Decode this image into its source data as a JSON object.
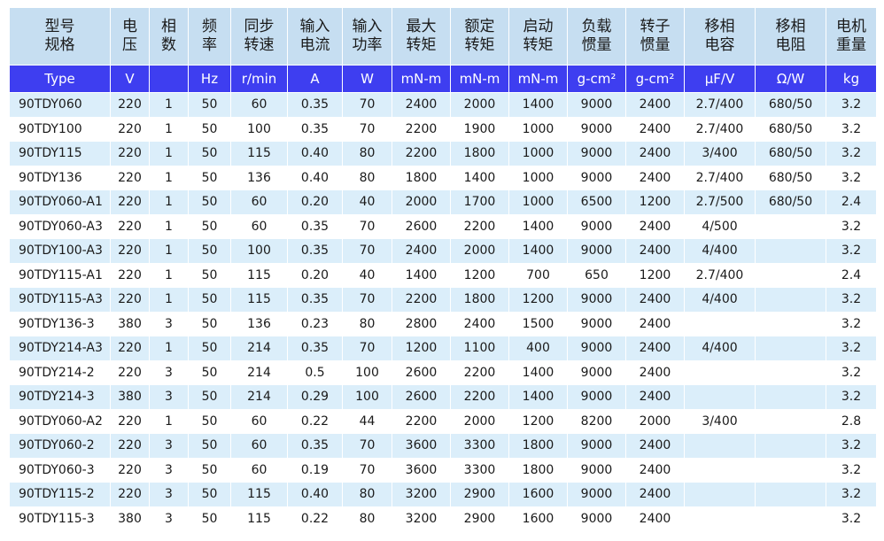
{
  "headers_cn": [
    "型号\n规格",
    "电\n压",
    "相\n数",
    "频\n率",
    "同步\n转速",
    "输入\n电流",
    "输入\n功率",
    "最大\n转矩",
    "额定\n转矩",
    "启动\n转矩",
    "负载\n惯量",
    "转子\n惯量",
    "移相\n电容",
    "移相\n电阻",
    "电机\n重量"
  ],
  "headers_unit": [
    "Type",
    "V",
    "",
    "Hz",
    "r/min",
    "A",
    "W",
    "mN-m",
    "mN-m",
    "mN-m",
    "g-cm²",
    "g-cm²",
    "μF/V",
    "Ω/W",
    "kg"
  ],
  "rows": [
    [
      "90TDY060",
      "220",
      "1",
      "50",
      "60",
      "0.35",
      "70",
      "2400",
      "2000",
      "1400",
      "9000",
      "2400",
      "2.7/400",
      "680/50",
      "3.2"
    ],
    [
      "90TDY100",
      "220",
      "1",
      "50",
      "100",
      "0.35",
      "70",
      "2200",
      "1900",
      "1000",
      "9000",
      "2400",
      "2.7/400",
      "680/50",
      "3.2"
    ],
    [
      "90TDY115",
      "220",
      "1",
      "50",
      "115",
      "0.40",
      "80",
      "2200",
      "1800",
      "1000",
      "9000",
      "2400",
      "3/400",
      "680/50",
      "3.2"
    ],
    [
      "90TDY136",
      "220",
      "1",
      "50",
      "136",
      "0.40",
      "80",
      "1800",
      "1400",
      "1000",
      "9000",
      "2400",
      "2.7/400",
      "680/50",
      "3.2"
    ],
    [
      "90TDY060-A1",
      "220",
      "1",
      "50",
      "60",
      "0.20",
      "40",
      "2000",
      "1700",
      "1000",
      "6500",
      "1200",
      "2.7/500",
      "680/50",
      "2.4"
    ],
    [
      "90TDY060-A3",
      "220",
      "1",
      "50",
      "60",
      "0.35",
      "70",
      "2600",
      "2200",
      "1400",
      "9000",
      "2400",
      "4/500",
      "",
      "3.2"
    ],
    [
      "90TDY100-A3",
      "220",
      "1",
      "50",
      "100",
      "0.35",
      "70",
      "2400",
      "2000",
      "1400",
      "9000",
      "2400",
      "4/400",
      "",
      "3.2"
    ],
    [
      "90TDY115-A1",
      "220",
      "1",
      "50",
      "115",
      "0.20",
      "40",
      "1400",
      "1200",
      "700",
      "650",
      "1200",
      "2.7/400",
      "",
      "2.4"
    ],
    [
      "90TDY115-A3",
      "220",
      "1",
      "50",
      "115",
      "0.35",
      "70",
      "2200",
      "1800",
      "1200",
      "9000",
      "2400",
      "4/400",
      "",
      "3.2"
    ],
    [
      "90TDY136-3",
      "380",
      "3",
      "50",
      "136",
      "0.23",
      "80",
      "2800",
      "2400",
      "1500",
      "9000",
      "2400",
      "",
      "",
      "3.2"
    ],
    [
      "90TDY214-A3",
      "220",
      "1",
      "50",
      "214",
      "0.35",
      "70",
      "1200",
      "1100",
      "400",
      "9000",
      "2400",
      "4/400",
      "",
      "3.2"
    ],
    [
      "90TDY214-2",
      "220",
      "3",
      "50",
      "214",
      "0.5",
      "100",
      "2600",
      "2200",
      "1400",
      "9000",
      "2400",
      "",
      "",
      "3.2"
    ],
    [
      "90TDY214-3",
      "380",
      "3",
      "50",
      "214",
      "0.29",
      "100",
      "2600",
      "2200",
      "1400",
      "9000",
      "2400",
      "",
      "",
      "3.2"
    ],
    [
      "90TDY060-A2",
      "220",
      "1",
      "50",
      "60",
      "0.22",
      "44",
      "2200",
      "2000",
      "1200",
      "8200",
      "2000",
      "3/400",
      "",
      "2.8"
    ],
    [
      "90TDY060-2",
      "220",
      "3",
      "50",
      "60",
      "0.35",
      "70",
      "3600",
      "3300",
      "1800",
      "9000",
      "2400",
      "",
      "",
      "3.2"
    ],
    [
      "90TDY060-3",
      "220",
      "3",
      "50",
      "60",
      "0.19",
      "70",
      "3600",
      "3300",
      "1800",
      "9000",
      "2400",
      "",
      "",
      "3.2"
    ],
    [
      "90TDY115-2",
      "220",
      "3",
      "50",
      "115",
      "0.40",
      "80",
      "3200",
      "2900",
      "1600",
      "9000",
      "2400",
      "",
      "",
      "3.2"
    ],
    [
      "90TDY115-3",
      "380",
      "3",
      "50",
      "115",
      "0.22",
      "80",
      "3200",
      "2900",
      "1600",
      "9000",
      "2400",
      "",
      "",
      "3.2"
    ]
  ]
}
